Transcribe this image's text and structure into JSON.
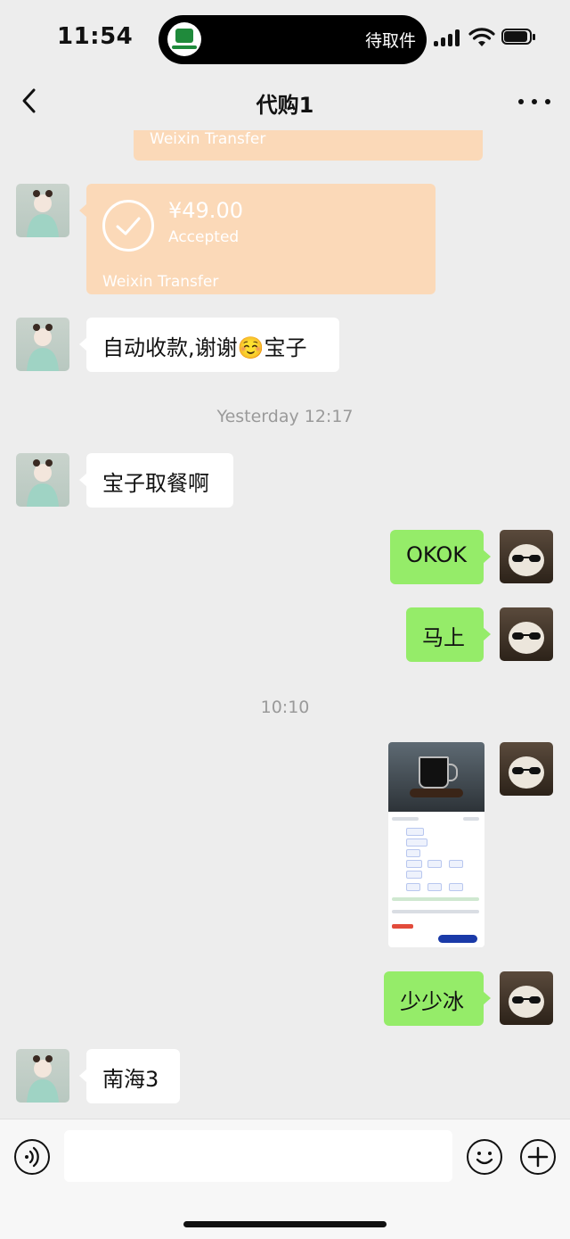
{
  "status_bar": {
    "time": "11:54",
    "island_text": "待取件",
    "icons": [
      "cellular-icon",
      "wifi-icon",
      "battery-icon"
    ]
  },
  "nav": {
    "title": "代购1",
    "back_icon": "chevron-left-icon",
    "more_icon": "more-icon"
  },
  "messages": {
    "partial_transfer_footer": "Weixin Transfer",
    "transfer": {
      "amount": "¥49.00",
      "status": "Accepted",
      "footer": "Weixin Transfer",
      "icon": "check-circle-icon"
    },
    "m1": "自动收款,谢谢☺️宝子",
    "ts1": "Yesterday 12:17",
    "m2": "宝子取餐啊",
    "m3": "OKOK",
    "m4": "马上",
    "ts2": "10:10",
    "m6": "少少冰",
    "m7": "南海3"
  },
  "input_bar": {
    "text_value": "",
    "placeholder": "",
    "icons": [
      "voice-icon",
      "emoji-icon",
      "plus-icon"
    ]
  },
  "colors": {
    "background": "#ededed",
    "outgoing_bubble": "#95ec69",
    "incoming_bubble": "#ffffff",
    "transfer_card": "#fbd9b8"
  }
}
